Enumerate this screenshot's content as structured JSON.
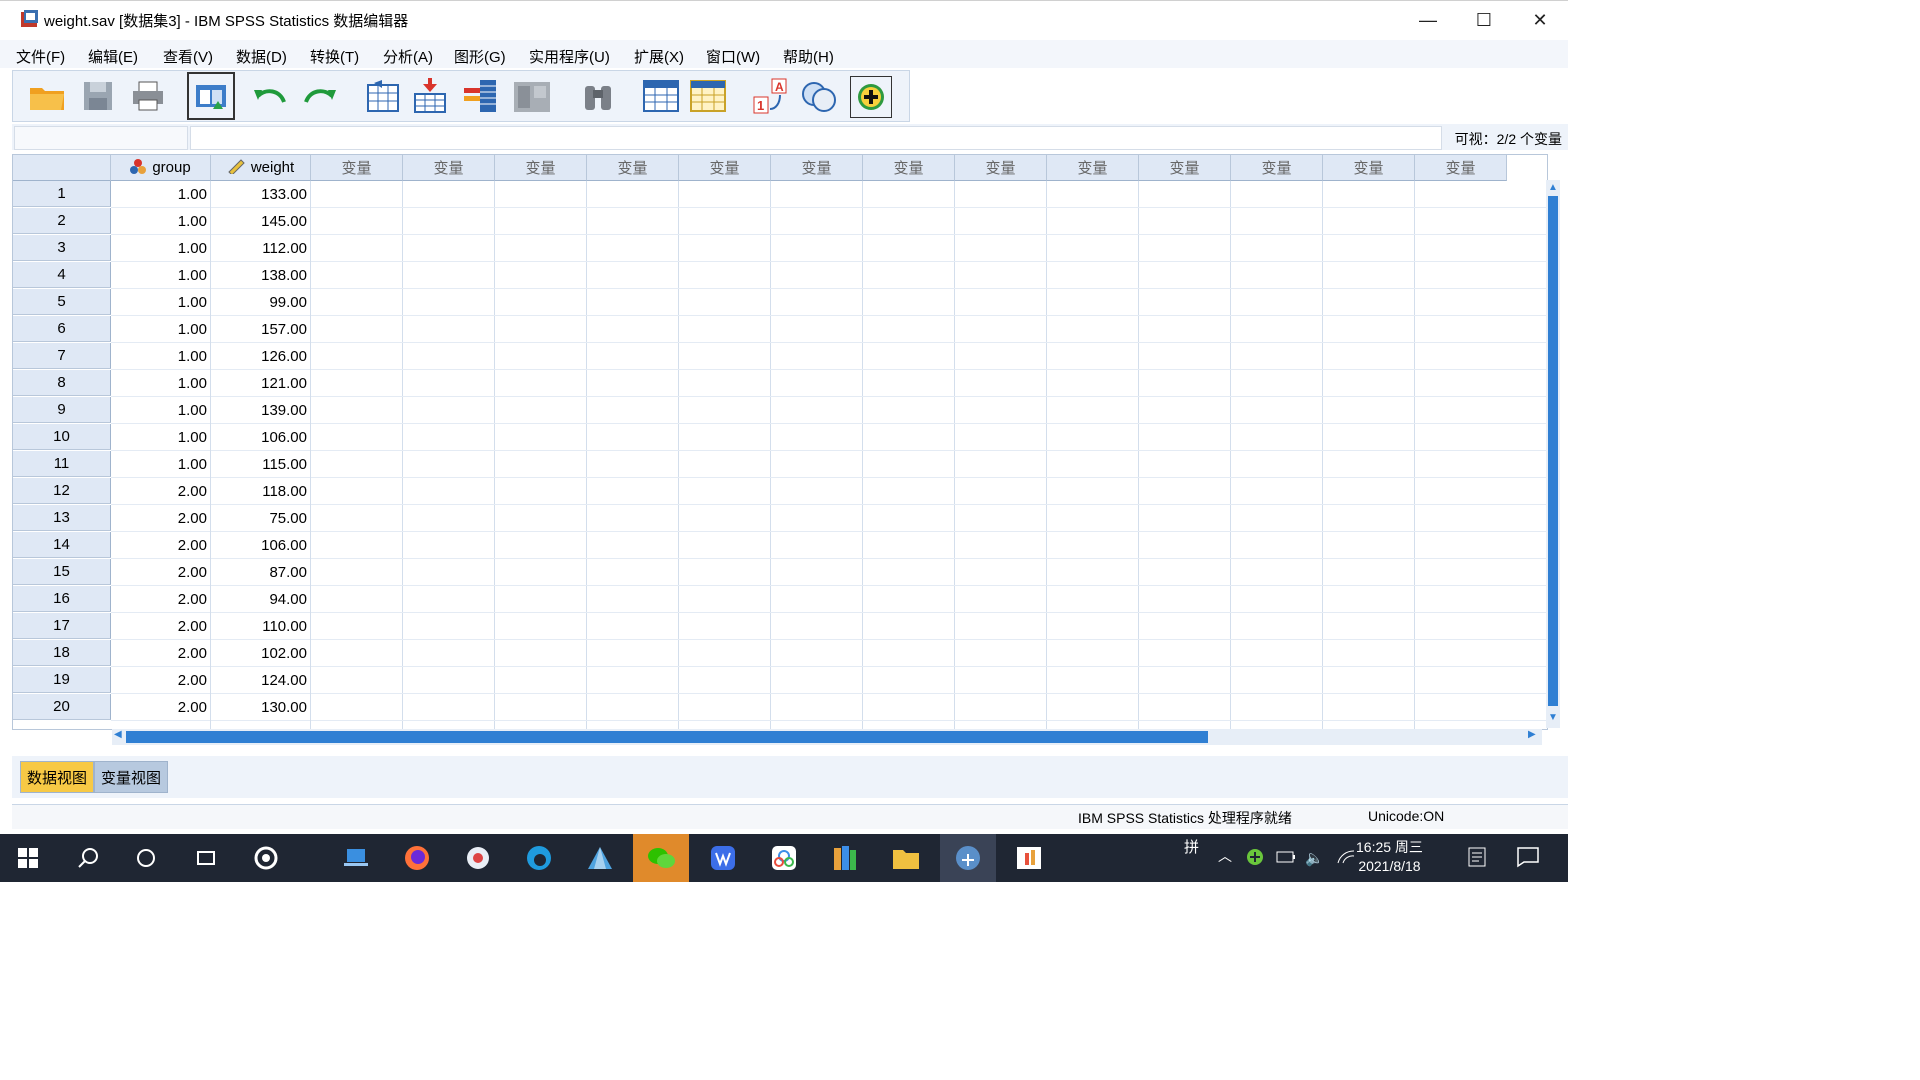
{
  "window": {
    "title": "weight.sav [数据集3] - IBM SPSS Statistics 数据编辑器",
    "controls": [
      "—",
      "☐",
      "✕"
    ]
  },
  "menu": [
    "文件(F)",
    "编辑(E)",
    "查看(V)",
    "数据(D)",
    "转换(T)",
    "分析(A)",
    "图形(G)",
    "实用程序(U)",
    "扩展(X)",
    "窗口(W)",
    "帮助(H)"
  ],
  "toolbar": {
    "icons": [
      "open-folder-icon",
      "save-icon",
      "print-icon",
      "dialog-recall-icon",
      "undo-icon",
      "redo-icon",
      "goto-case-icon",
      "goto-variable-icon",
      "variables-icon",
      "find-icon",
      "insert-cases-icon",
      "insert-variable-icon",
      "split-file-icon",
      "weight-cases-icon",
      "value-labels-icon",
      "extension-icon"
    ]
  },
  "cellbar": {
    "visible_label": "可视：2/2 个变量"
  },
  "grid": {
    "columns": [
      {
        "name": "group",
        "icon": "nominal-icon"
      },
      {
        "name": "weight",
        "icon": "scale-icon"
      }
    ],
    "empty_column_label": "变量",
    "empty_columns": 13,
    "rows": [
      [
        "1",
        "1.00",
        "133.00"
      ],
      [
        "2",
        "1.00",
        "145.00"
      ],
      [
        "3",
        "1.00",
        "112.00"
      ],
      [
        "4",
        "1.00",
        "138.00"
      ],
      [
        "5",
        "1.00",
        "99.00"
      ],
      [
        "6",
        "1.00",
        "157.00"
      ],
      [
        "7",
        "1.00",
        "126.00"
      ],
      [
        "8",
        "1.00",
        "121.00"
      ],
      [
        "9",
        "1.00",
        "139.00"
      ],
      [
        "10",
        "1.00",
        "106.00"
      ],
      [
        "11",
        "1.00",
        "115.00"
      ],
      [
        "12",
        "2.00",
        "118.00"
      ],
      [
        "13",
        "2.00",
        "75.00"
      ],
      [
        "14",
        "2.00",
        "106.00"
      ],
      [
        "15",
        "2.00",
        "87.00"
      ],
      [
        "16",
        "2.00",
        "94.00"
      ],
      [
        "17",
        "2.00",
        "110.00"
      ],
      [
        "18",
        "2.00",
        "102.00"
      ],
      [
        "19",
        "2.00",
        "124.00"
      ],
      [
        "20",
        "2.00",
        "130.00"
      ]
    ]
  },
  "tabs": {
    "data_view": "数据视图",
    "variable_view": "变量视图"
  },
  "statusbar": {
    "processor": "IBM SPSS Statistics 处理程序就绪",
    "unicode": "Unicode:ON"
  },
  "taskbar": {
    "ime": "拼",
    "time": "16:25 周三",
    "date": "2021/8/18"
  }
}
